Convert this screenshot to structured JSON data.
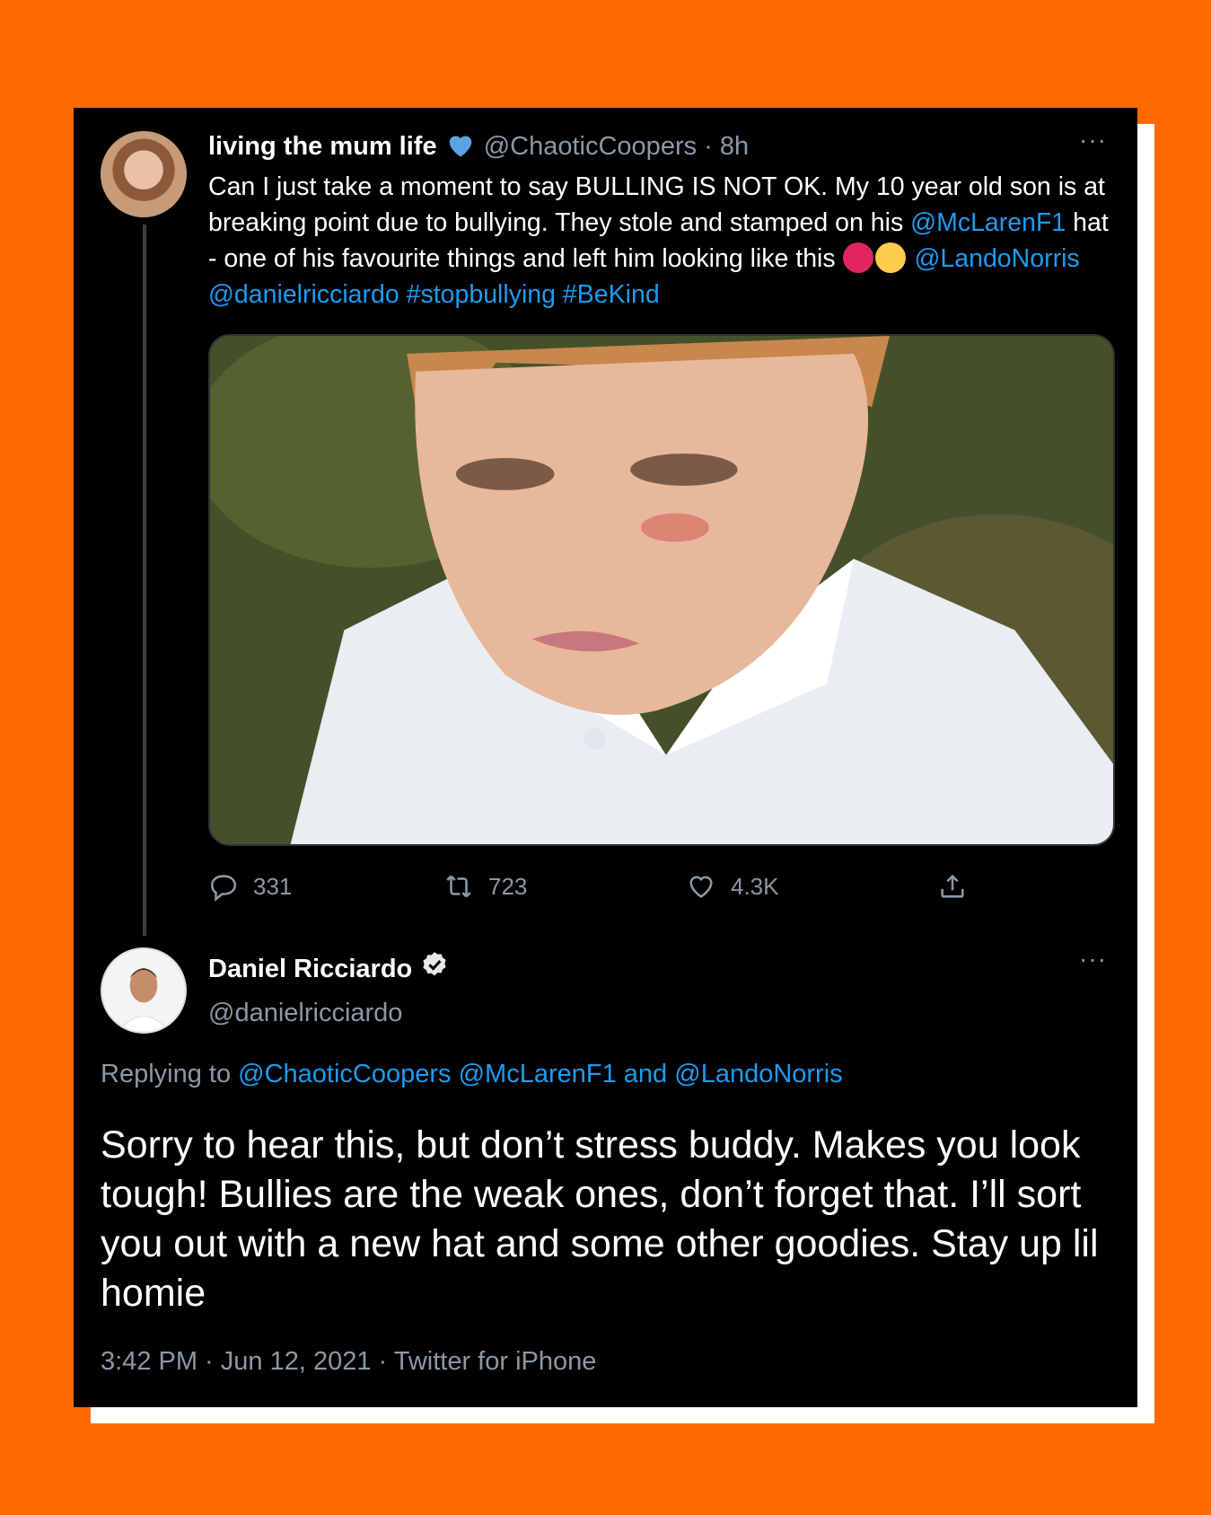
{
  "colors": {
    "background": "#ff6a00",
    "card": "#000000",
    "link": "#1d9bf0",
    "muted": "#8b98a5",
    "text": "#ffffff"
  },
  "tweet1": {
    "display_name": "living the mum life",
    "handle_time": "@ChaoticCoopers · 8h",
    "more": "···",
    "text_parts": [
      "Can I just take a moment to say BULLING IS NOT OK. My 10 year old son is at breaking point due to bullying. They stole and stamped on his ",
      "@McLarenF1",
      " hat - one of his favourite things and left him looking like this ",
      "@LandoNorris",
      "@danielricciardo",
      "#stopbullying",
      "#BeKind"
    ],
    "emoji": [
      "angry-face",
      "face-with-rolling-eyes"
    ],
    "stats": {
      "replies": "331",
      "retweets": "723",
      "likes": "4.3K"
    }
  },
  "tweet2": {
    "display_name": "Daniel Ricciardo",
    "handle": "@danielricciardo",
    "more": "···",
    "replying_prefix": "Replying to ",
    "replying_to": [
      "@ChaoticCoopers",
      "@McLarenF1",
      "and",
      "@LandoNorris"
    ],
    "text": "Sorry to hear this, but don’t stress buddy. Makes you look tough! Bullies are the weak ones, don’t forget that. I’ll sort you out with a new hat and some other goodies. Stay up lil homie",
    "meta": "3:42 PM · Jun 12, 2021 · Twitter for iPhone"
  }
}
